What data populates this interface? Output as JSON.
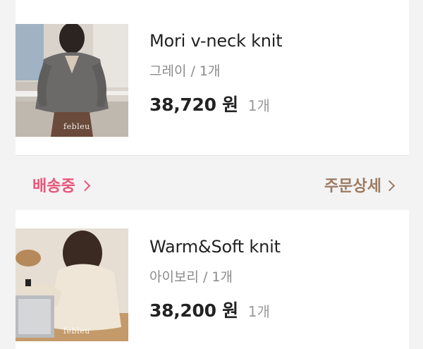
{
  "orders": [
    {
      "product_name": "Mori v-neck knit",
      "option": "그레이 / 1개",
      "price": "38,720 원",
      "quantity": "1개",
      "image_brand": "febleu"
    },
    {
      "product_name": "Warm&Soft knit",
      "option": "아이보리 / 1개",
      "price": "38,200 원",
      "quantity": "1개",
      "image_brand": "febleu"
    }
  ],
  "status_bar": {
    "status_label": "배송중",
    "detail_label": "주문상세",
    "status_color": "#e8557a",
    "detail_color": "#9c7b62"
  },
  "icons": [
    "chevron-right-icon"
  ]
}
